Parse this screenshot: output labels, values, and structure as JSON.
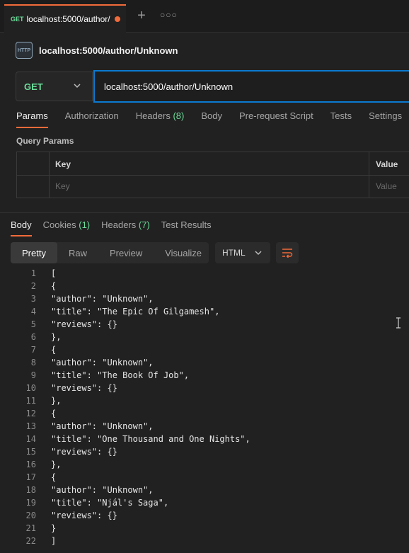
{
  "tab": {
    "method": "GET",
    "title": "localhost:5000/author/"
  },
  "request": {
    "name": "localhost:5000/author/Unknown",
    "icon_label": "HTTP"
  },
  "url_bar": {
    "method": "GET",
    "url": "localhost:5000/author/Unknown"
  },
  "request_tabs": [
    {
      "label": "Params",
      "count": ""
    },
    {
      "label": "Authorization",
      "count": ""
    },
    {
      "label": "Headers",
      "count": "(8)"
    },
    {
      "label": "Body",
      "count": ""
    },
    {
      "label": "Pre-request Script",
      "count": ""
    },
    {
      "label": "Tests",
      "count": ""
    },
    {
      "label": "Settings",
      "count": ""
    }
  ],
  "query_params": {
    "label": "Query Params",
    "columns": [
      "Key",
      "Value"
    ],
    "placeholders": {
      "key": "Key",
      "value": "Value"
    }
  },
  "response_tabs": [
    {
      "label": "Body",
      "count": ""
    },
    {
      "label": "Cookies",
      "count": "(1)"
    },
    {
      "label": "Headers",
      "count": "(7)"
    },
    {
      "label": "Test Results",
      "count": ""
    }
  ],
  "view_modes": [
    "Pretty",
    "Raw",
    "Preview",
    "Visualize"
  ],
  "format": "HTML",
  "code_lines": [
    "[",
    "{",
    "\"author\": \"Unknown\",",
    "\"title\": \"The Epic Of Gilgamesh\",",
    "\"reviews\": {}",
    "},",
    "{",
    "\"author\": \"Unknown\",",
    "\"title\": \"The Book Of Job\",",
    "\"reviews\": {}",
    "},",
    "{",
    "\"author\": \"Unknown\",",
    "\"title\": \"One Thousand and One Nights\",",
    "\"reviews\": {}",
    "},",
    "{",
    "\"author\": \"Unknown\",",
    "\"title\": \"Njál's Saga\",",
    "\"reviews\": {}",
    "}",
    "]"
  ],
  "colors": {
    "accent": "#f26b3a",
    "get_method": "#6bdd9a",
    "focus_border": "#0b7ad1"
  }
}
